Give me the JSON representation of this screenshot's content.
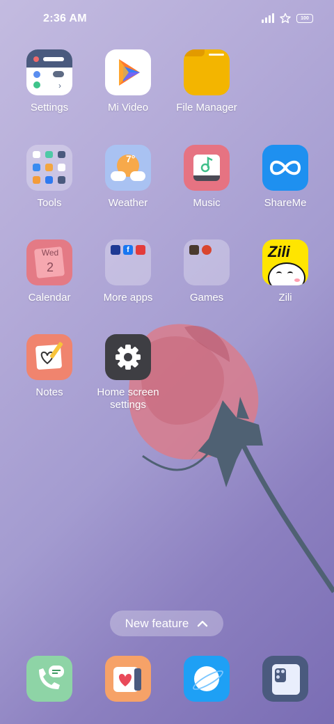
{
  "status_bar": {
    "time": "2:36 AM",
    "battery": "100",
    "icons": [
      "signal-icon",
      "star-icon",
      "battery-icon"
    ]
  },
  "apps": {
    "settings": "Settings",
    "mi_video": "Mi Video",
    "file_manager": "File Manager",
    "tools": "Tools",
    "weather": "Weather",
    "music": "Music",
    "shareme": "ShareMe",
    "calendar": "Calendar",
    "more_apps": "More apps",
    "games": "Games",
    "zili": "Zili",
    "notes": "Notes",
    "home_screen_settings_line1": "Home screen",
    "home_screen_settings_line2": "settings"
  },
  "icon_text": {
    "weather_temp": "7°",
    "calendar_day": "Wed",
    "calendar_date": "2",
    "zili_logo": "Zili"
  },
  "new_feature": "New feature",
  "dock": [
    "phone-icon",
    "security-icon",
    "browser-icon",
    "camera-icon"
  ],
  "colors": {
    "file_manager": "#f3b500",
    "shareme": "#1e90f0",
    "music": "#e67382",
    "calendar": "#e47a85",
    "notes": "#f0846e",
    "zili": "#ffe500",
    "home_settings": "#3e3e43"
  }
}
